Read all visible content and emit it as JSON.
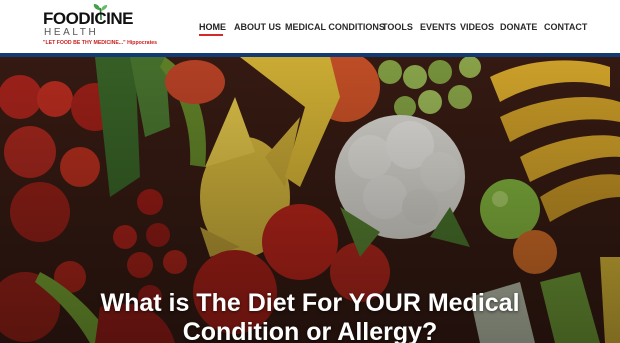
{
  "brand": {
    "name_top": "FOODICINE",
    "name_bottom": "HEALTH",
    "tagline": "\"LET FOOD BE THY MEDICINE...\" Hippocrates",
    "logo_icon": "sprout-icon"
  },
  "nav": {
    "items": [
      {
        "label": "HOME",
        "active": true
      },
      {
        "label": "ABOUT US",
        "active": false
      },
      {
        "label": "MEDICAL CONDITIONS",
        "active": false
      },
      {
        "label": "TOOLS",
        "active": false
      },
      {
        "label": "EVENTS",
        "active": false
      },
      {
        "label": "VIDEOS",
        "active": false
      },
      {
        "label": "DONATE",
        "active": false
      },
      {
        "label": "CONTACT",
        "active": false
      }
    ],
    "active_color": "#d02a2a",
    "text_color": "#2a2a2a"
  },
  "colors": {
    "header_rule": "#123a73",
    "hero_title": "#ffffff"
  },
  "hero": {
    "title_line1": "What is The Diet For YOUR Medical",
    "title_line2": "Condition or Allergy?"
  }
}
